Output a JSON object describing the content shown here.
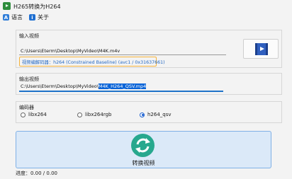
{
  "window": {
    "title": "H265转换为H264"
  },
  "menu": {
    "language": "语言",
    "about": "关于"
  },
  "input": {
    "group_label": "输入视频",
    "path": "C:\\Users\\Eterm\\Desktop\\MyVideo\\M4K.m4v",
    "decoder_info": "视频编解码器：h264 (Constrained Baseline) (avc1 / 0x31637661)"
  },
  "output": {
    "group_label": "输出视频",
    "path_prefix": "C:\\Users\\Eterm\\Desktop\\MyVideo\\",
    "path_selected": "M4K_H264_QSV.mp4"
  },
  "encoder": {
    "group_label": "编码器",
    "options": [
      "libx264",
      "libx264rgb",
      "h264_qsv"
    ],
    "selected": "h264_qsv"
  },
  "convert_button": {
    "label": "转换视频"
  },
  "progress": {
    "text": "进度：0.00 / 0.00"
  },
  "colors": {
    "accent": "#0a64d8",
    "highlight_border": "#f5b23a",
    "convert_icon": "#27a88e"
  }
}
